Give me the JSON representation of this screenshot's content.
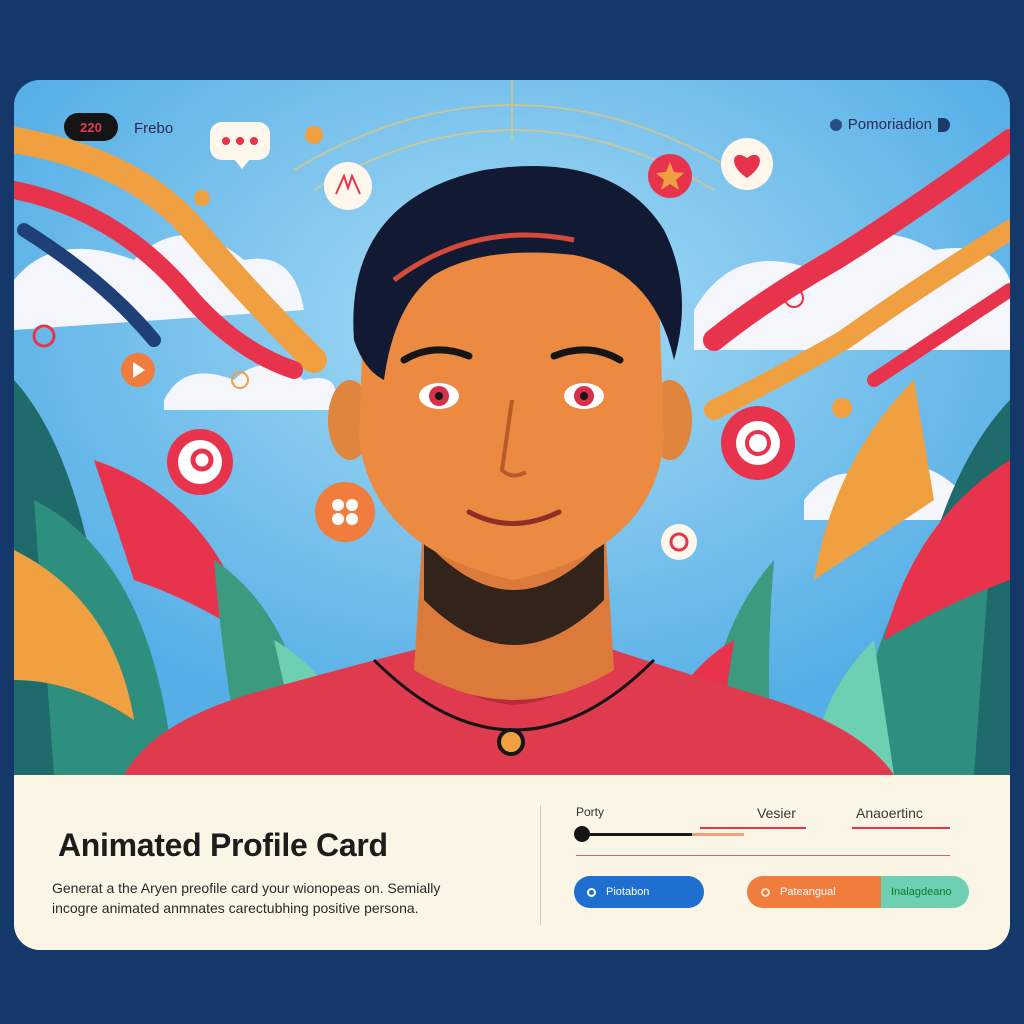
{
  "header": {
    "badge": "220",
    "label": "Frebo",
    "promo": "Pomoriadion"
  },
  "panel": {
    "title": "Animated Profile Card",
    "description_line1": "Generat a the Aryen preofile card your wionopeas on. Semially",
    "description_line2": "incogre animated anmnates carectubhing positive persona.",
    "label_left": "Porty",
    "label_mid": "Vesier",
    "label_right": "Anaoertinc",
    "slider_value": 0.72,
    "button_primary": "Piotabon",
    "button_secondary": "Pateangual",
    "button_tertiary": "Inalagdeano"
  },
  "colors": {
    "background": "#15386a",
    "sky": "#5fb7ea",
    "accent_red": "#e8334c",
    "accent_orange": "#f07c3e",
    "accent_blue": "#1f6fd1",
    "accent_teal": "#6fcfb2",
    "panel": "#fbf5e6"
  },
  "icons": {
    "chat": "chat-bubble-icon",
    "star": "star-icon",
    "heart": "heart-icon",
    "play": "play-icon",
    "location": "location-pin-icon",
    "flower": "flower-icon",
    "target": "target-icon"
  }
}
